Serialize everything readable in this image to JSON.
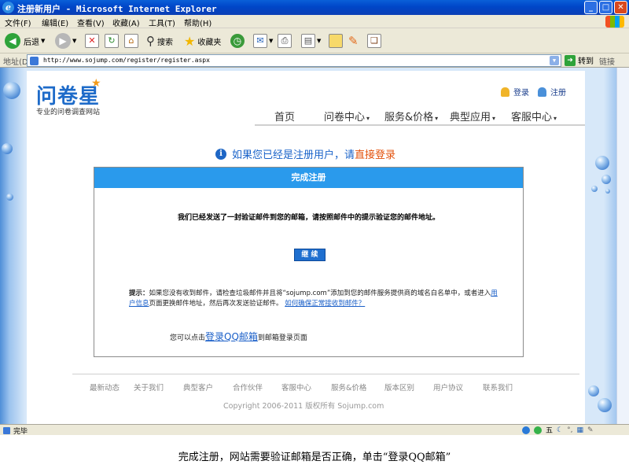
{
  "window": {
    "title": "注册新用户 - Microsoft Internet Explorer",
    "controls": {
      "minimize": "_",
      "maximize": "□",
      "close": "✕"
    }
  },
  "menu": [
    "文件(F)",
    "编辑(E)",
    "查看(V)",
    "收藏(A)",
    "工具(T)",
    "帮助(H)"
  ],
  "toolbar": {
    "back": "后退",
    "search": "搜索",
    "favorites": "收藏夹"
  },
  "address": {
    "label": "地址(D)",
    "url": "http://www.sojump.com/register/register.aspx",
    "go": "转到",
    "links": "链接"
  },
  "site": {
    "logo": "问卷星",
    "tagline": "专业的问卷调查网站",
    "login": "登录",
    "register": "注册",
    "nav": [
      {
        "label": "首页",
        "dropdown": false
      },
      {
        "label": "问卷中心",
        "dropdown": true
      },
      {
        "label": "服务&价格",
        "dropdown": true
      },
      {
        "label": "典型应用",
        "dropdown": true
      },
      {
        "label": "客服中心",
        "dropdown": true
      }
    ],
    "notice_text": "如果您已经是注册用户，请",
    "notice_link": "直接登录"
  },
  "panel": {
    "title": "完成注册",
    "message": "我们已经发送了一封验证邮件到您的邮箱，请按照邮件中的提示验证您的邮件地址。",
    "continue_button": "继 续",
    "tip_lead": "提示：",
    "tip_part1": "如果您没有收到邮件，请检查垃圾邮件并且将“sojump.com”添加到您的邮件服务提供商的域名白名单中，或者进入",
    "tip_link1": "用户信息",
    "tip_part2": "页面更换邮件地址，然后再次发送验证邮件。",
    "tip_link2": "如何确保正常接收到邮件？",
    "qq_prefix": "您可以点击",
    "qq_link": "登录QQ邮箱",
    "qq_suffix": "到邮箱登录页面"
  },
  "footer": {
    "links": [
      "最新动态",
      "关于我们",
      "典型客户",
      "合作伙伴",
      "客服中心",
      "服务&价格",
      "版本区别",
      "用户协议",
      "联系我们"
    ],
    "copyright": "Copyright 2006-2011 版权所有 Sojump.com"
  },
  "status": {
    "text": "完毕",
    "ime": "五"
  },
  "caption": "完成注册，网站需要验证邮箱是否正确，单击“登录QQ邮箱”",
  "colors": {
    "titlebar": "#0046c8",
    "panel_header": "#2a9aec",
    "link_orange": "#e3510b",
    "notice_blue": "#1a63c9",
    "button_blue": "#1f6fcf"
  }
}
